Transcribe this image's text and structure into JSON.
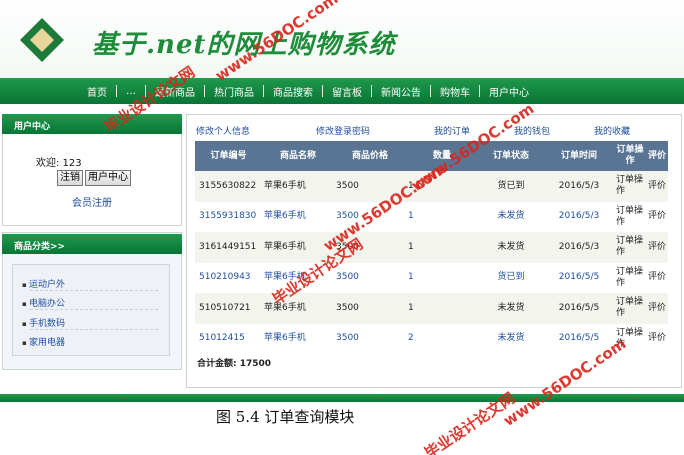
{
  "header": {
    "site_title": "基于.net的网上购物系统"
  },
  "nav": {
    "items": [
      "首页",
      "…",
      "最新商品",
      "热门商品",
      "商品搜索",
      "留言板",
      "新闻公告",
      "购物车",
      "用户中心"
    ]
  },
  "user_center": {
    "title": "用户中心",
    "welcome": "欢迎: 123",
    "logout_label": "注销",
    "center_label": "用户中心",
    "register_label": "会员注册"
  },
  "categories": {
    "title": "商品分类>>",
    "items": [
      "运动户外",
      "电脑办公",
      "手机数码",
      "家用电器"
    ]
  },
  "main": {
    "sublinks": [
      "修改个人信息",
      "修改登录密码",
      "我的订单",
      "我的钱包",
      "我的收藏"
    ],
    "columns": [
      "订单编号",
      "商品名称",
      "商品价格",
      "数量",
      "订单状态",
      "订单时间",
      "订单操作",
      "评价"
    ],
    "rows": [
      {
        "id": "3155630822",
        "name": "苹果6手机",
        "price": "3500",
        "qty": "1",
        "status": "货已到",
        "date": "2016/5/3",
        "op": "订单操作",
        "review": "评价"
      },
      {
        "id": "3155931830",
        "name": "苹果6手机",
        "price": "3500",
        "qty": "1",
        "status": "未发货",
        "date": "2016/5/3",
        "op": "订单操作",
        "review": "评价"
      },
      {
        "id": "3161449151",
        "name": "苹果6手机",
        "price": "3500",
        "qty": "1",
        "status": "未发货",
        "date": "2016/5/3",
        "op": "订单操作",
        "review": "评价"
      },
      {
        "id": "510210943",
        "name": "苹果6手机",
        "price": "3500",
        "qty": "1",
        "status": "货已到",
        "date": "2016/5/5",
        "op": "订单操作",
        "review": "评价"
      },
      {
        "id": "510510721",
        "name": "苹果6手机",
        "price": "3500",
        "qty": "1",
        "status": "未发货",
        "date": "2016/5/5",
        "op": "订单操作",
        "review": "评价"
      },
      {
        "id": "51012415",
        "name": "苹果6手机",
        "price": "3500",
        "qty": "2",
        "status": "未发货",
        "date": "2016/5/5",
        "op": "订单操作",
        "review": "评价"
      }
    ],
    "total": "合计金额: 17500"
  },
  "caption": "图  5.4  订单查询模块",
  "watermark": {
    "site": "www.56DOC.com",
    "text": "毕业设计论文网"
  },
  "colors": {
    "brand_green": "#0f8040",
    "table_header": "#5a7493",
    "link_blue": "#1f4e9c",
    "watermark_red": "#d9261c"
  }
}
